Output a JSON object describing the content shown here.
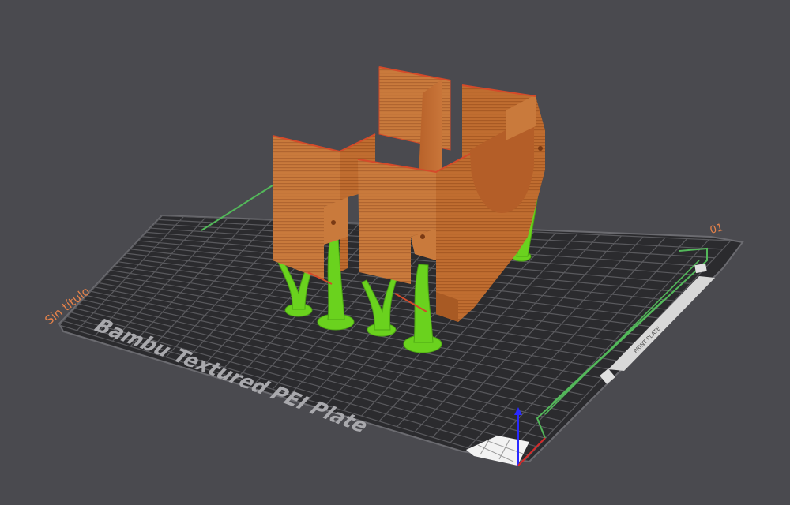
{
  "viewport": {
    "background": "#4a4a4f",
    "plate_color": "#2b2b2e",
    "grid_color": "#5a5a5e",
    "border_color": "#6b6b70",
    "model_color": "#c8712f",
    "model_edge_color": "#d44a2a",
    "support_color": "#6ad21e",
    "accent_color": "#e8834a",
    "outline_color": "#53b85a"
  },
  "plate": {
    "name": "Bambu Textured PEI Plate",
    "title": "Sin título",
    "index": "01",
    "label_small": "PRINT PLATE"
  },
  "axes": {
    "z_color": "#2a2aff",
    "x_color": "#d42a2a"
  },
  "icons": [
    "plate-name-icon",
    "z-axis-icon",
    "x-axis-icon",
    "origin-marker-icon"
  ]
}
